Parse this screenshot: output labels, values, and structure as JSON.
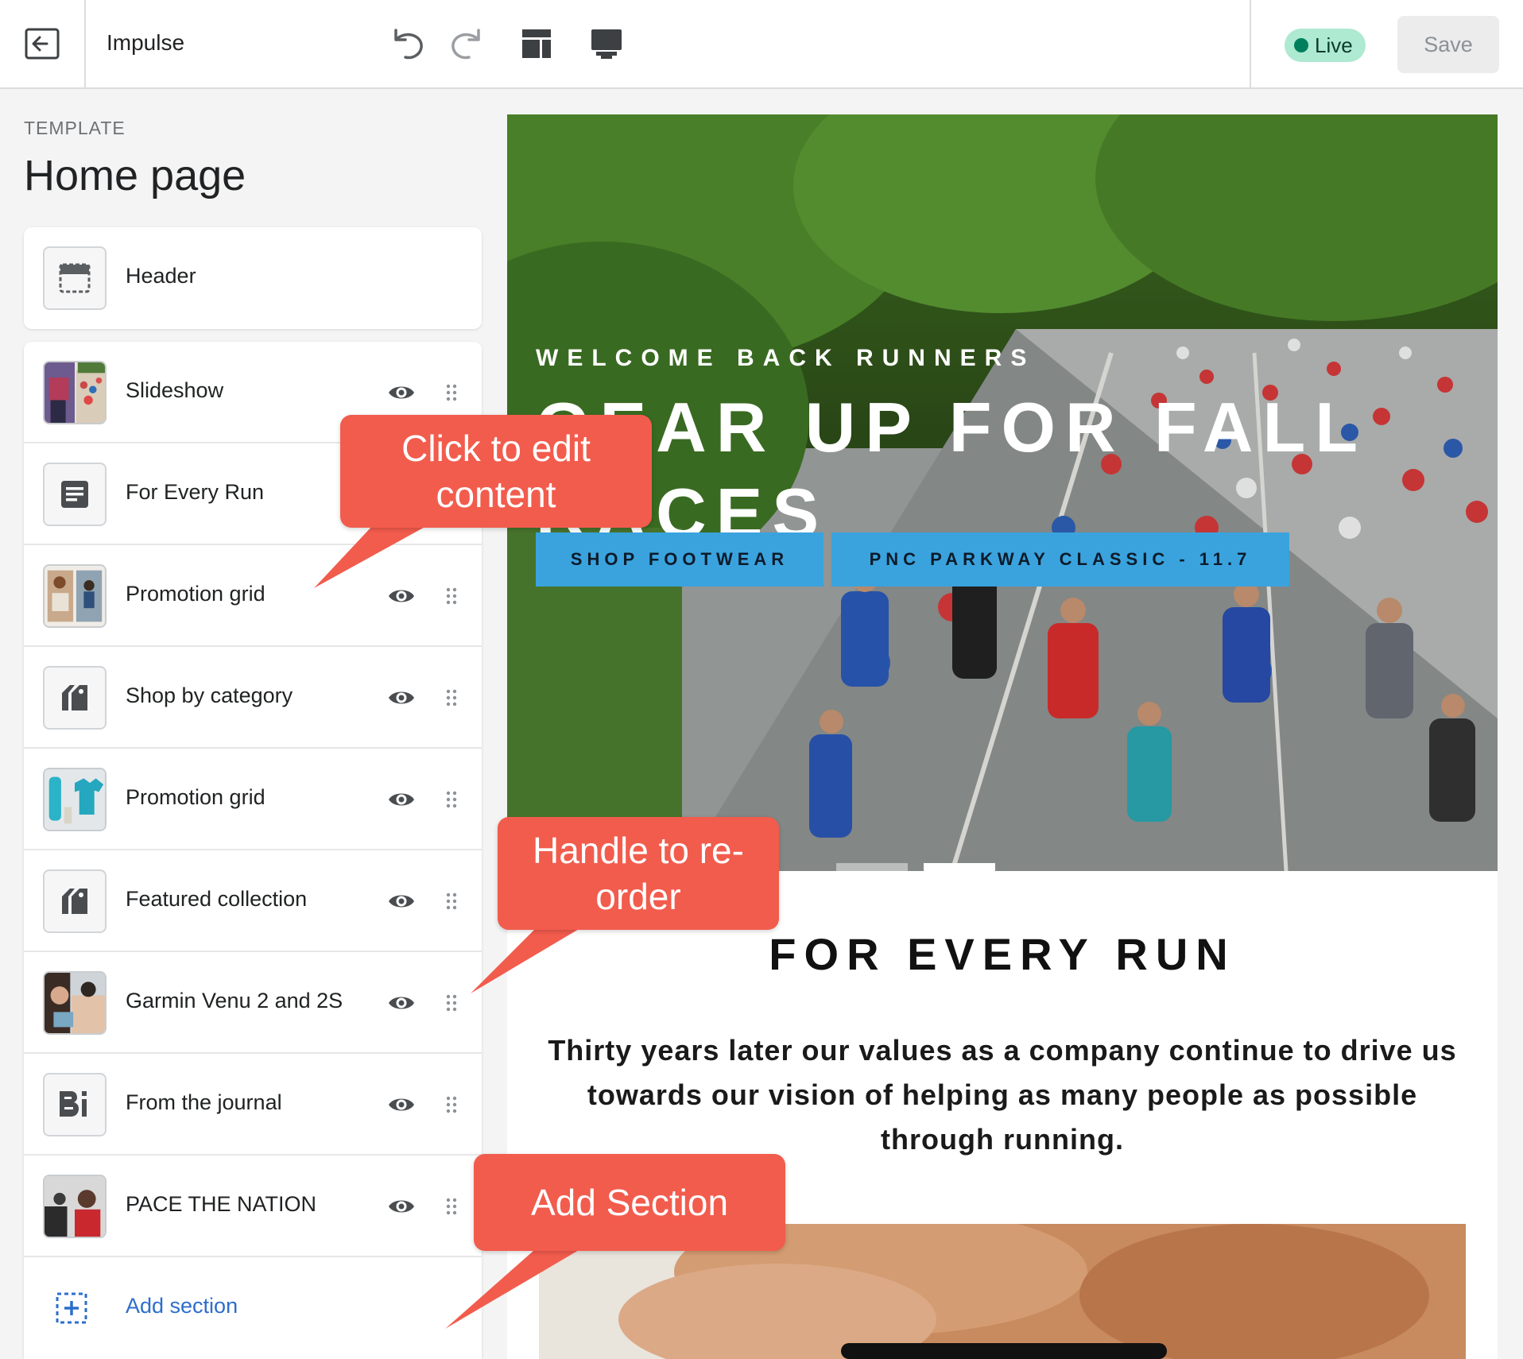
{
  "topbar": {
    "theme_name": "Impulse",
    "status": "Live",
    "save_label": "Save",
    "colors": {
      "live_bg": "#aee9d1",
      "live_dot": "#007f5f"
    }
  },
  "sidebar": {
    "template_label": "TEMPLATE",
    "page_title": "Home page",
    "header_label": "Header",
    "sections": [
      {
        "label": "Slideshow",
        "icon": "slideshow-thumbnail"
      },
      {
        "label": "For Every Run",
        "icon": "text-icon"
      },
      {
        "label": "Promotion grid",
        "icon": "promotion-thumbnail"
      },
      {
        "label": "Shop by category",
        "icon": "tag-icon"
      },
      {
        "label": "Promotion grid",
        "icon": "apparel-thumbnail"
      },
      {
        "label": "Featured collection",
        "icon": "tag-icon"
      },
      {
        "label": "Garmin Venu 2 and 2S",
        "icon": "watch-thumbnail"
      },
      {
        "label": "From the journal",
        "icon": "blog-icon"
      },
      {
        "label": "PACE THE NATION",
        "icon": "runner-thumbnail"
      }
    ],
    "add_section_label": "Add section"
  },
  "preview": {
    "hero": {
      "kicker": "WELCOME BACK RUNNERS",
      "title": "GEAR UP FOR FALL RACES",
      "buttons": [
        "SHOP FOOTWEAR",
        "PNC PARKWAY CLASSIC - 11.7"
      ]
    },
    "for_every_run": {
      "heading": "FOR EVERY RUN",
      "text": "Thirty years later our values as a company continue to drive us towards our vision of helping as many people as possible through running."
    }
  },
  "callouts": {
    "edit": "Click to edit content",
    "reorder": "Handle to re-order",
    "add": "Add Section",
    "color": "#f25c4d"
  }
}
